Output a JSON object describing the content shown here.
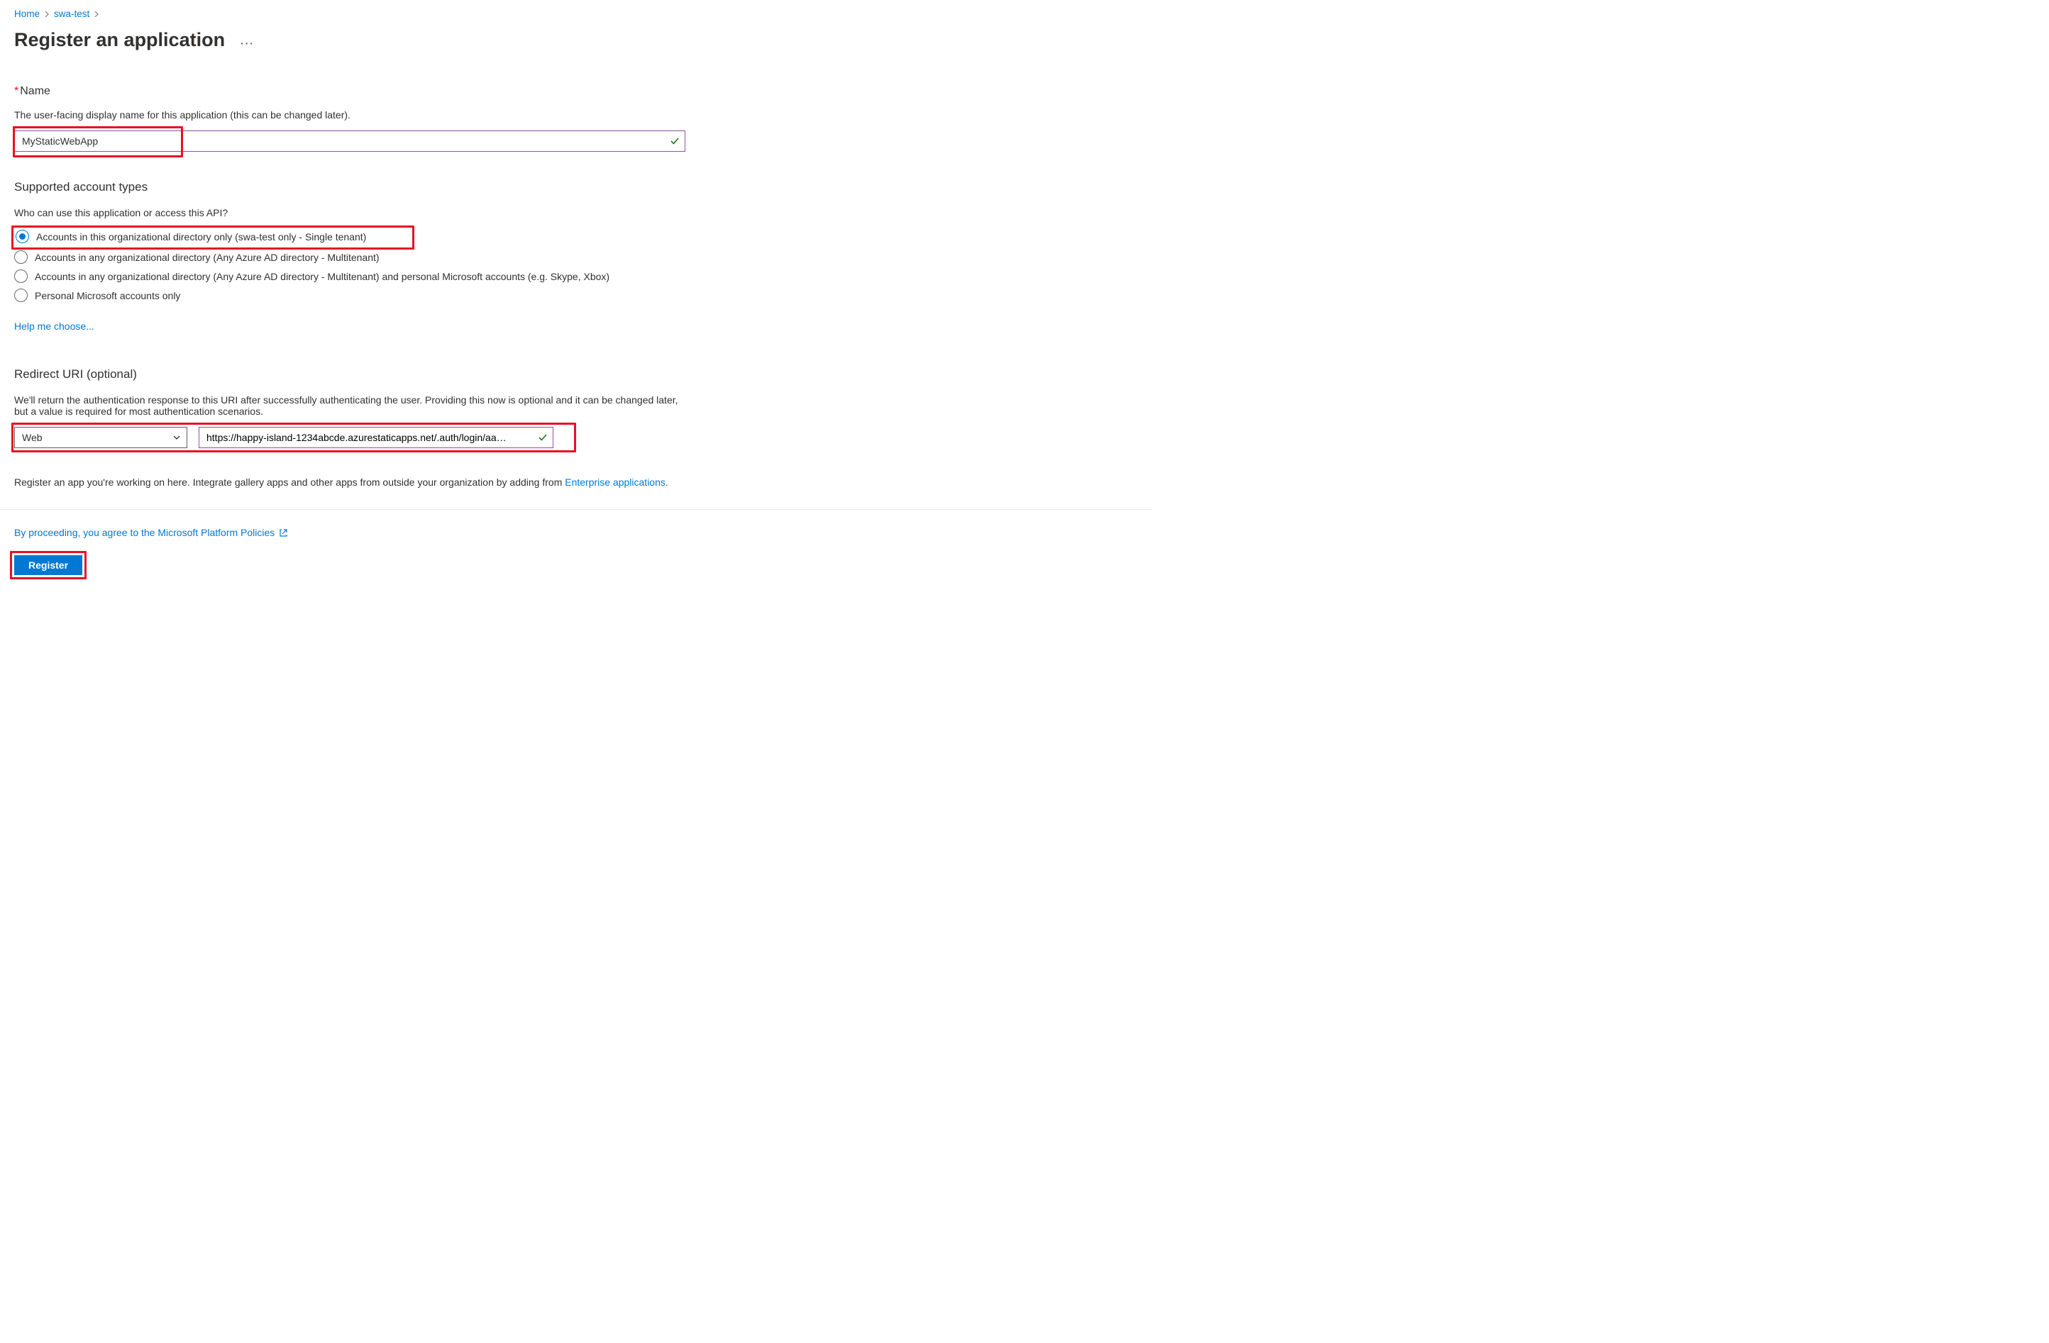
{
  "breadcrumb": {
    "home": "Home",
    "item1": "swa-test"
  },
  "page_title": "Register an application",
  "name_section": {
    "label": "Name",
    "desc": "The user-facing display name for this application (this can be changed later).",
    "value": "MyStaticWebApp"
  },
  "account_types": {
    "title": "Supported account types",
    "subtitle": "Who can use this application or access this API?",
    "options": [
      "Accounts in this organizational directory only (swa-test only - Single tenant)",
      "Accounts in any organizational directory (Any Azure AD directory - Multitenant)",
      "Accounts in any organizational directory (Any Azure AD directory - Multitenant) and personal Microsoft accounts (e.g. Skype, Xbox)",
      "Personal Microsoft accounts only"
    ],
    "help_link": "Help me choose..."
  },
  "redirect": {
    "title": "Redirect URI (optional)",
    "desc": "We'll return the authentication response to this URI after successfully authenticating the user. Providing this now is optional and it can be changed later, but a value is required for most authentication scenarios.",
    "platform": "Web",
    "uri": "https://happy-island-1234abcde.azurestaticapps.net/.auth/login/aa…"
  },
  "footer": {
    "note_pre": "Register an app you're working on here. Integrate gallery apps and other apps from outside your organization by adding from ",
    "note_link": "Enterprise applications",
    "note_post": ".",
    "policies": "By proceeding, you agree to the Microsoft Platform Policies",
    "register_label": "Register"
  }
}
